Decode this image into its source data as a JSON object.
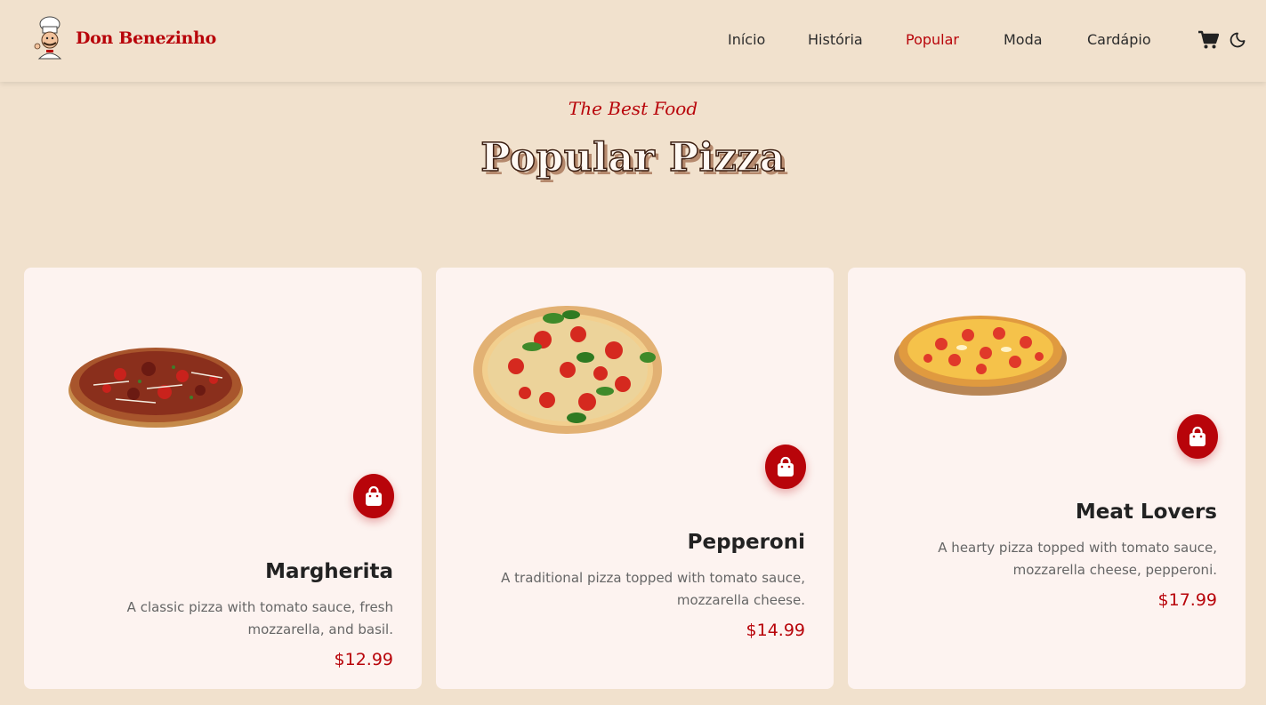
{
  "brand": {
    "name": "Don Benezinho"
  },
  "nav": {
    "items": [
      {
        "label": "Início",
        "active": false
      },
      {
        "label": "História",
        "active": false
      },
      {
        "label": "Popular",
        "active": true
      },
      {
        "label": "Moda",
        "active": false
      },
      {
        "label": "Cardápio",
        "active": false
      }
    ]
  },
  "icons": {
    "cart": "cart-icon",
    "theme": "moon-icon",
    "add": "shopping-bag-icon"
  },
  "hero": {
    "subtitle": "The Best Food",
    "title": "Popular Pizza"
  },
  "cards": [
    {
      "name": "Margherita",
      "description": "A classic pizza with tomato sauce, fresh mozzarella, and basil.",
      "price": "$12.99"
    },
    {
      "name": "Pepperoni",
      "description": "A traditional pizza topped with tomato sauce, mozzarella cheese.",
      "price": "$14.99"
    },
    {
      "name": "Meat Lovers",
      "description": "A hearty pizza topped with tomato sauce, mozzarella cheese, pepperoni.",
      "price": "$17.99"
    }
  ],
  "colors": {
    "accent": "#b8040a",
    "background": "#f1e1cd",
    "card": "#fdf3f0"
  }
}
